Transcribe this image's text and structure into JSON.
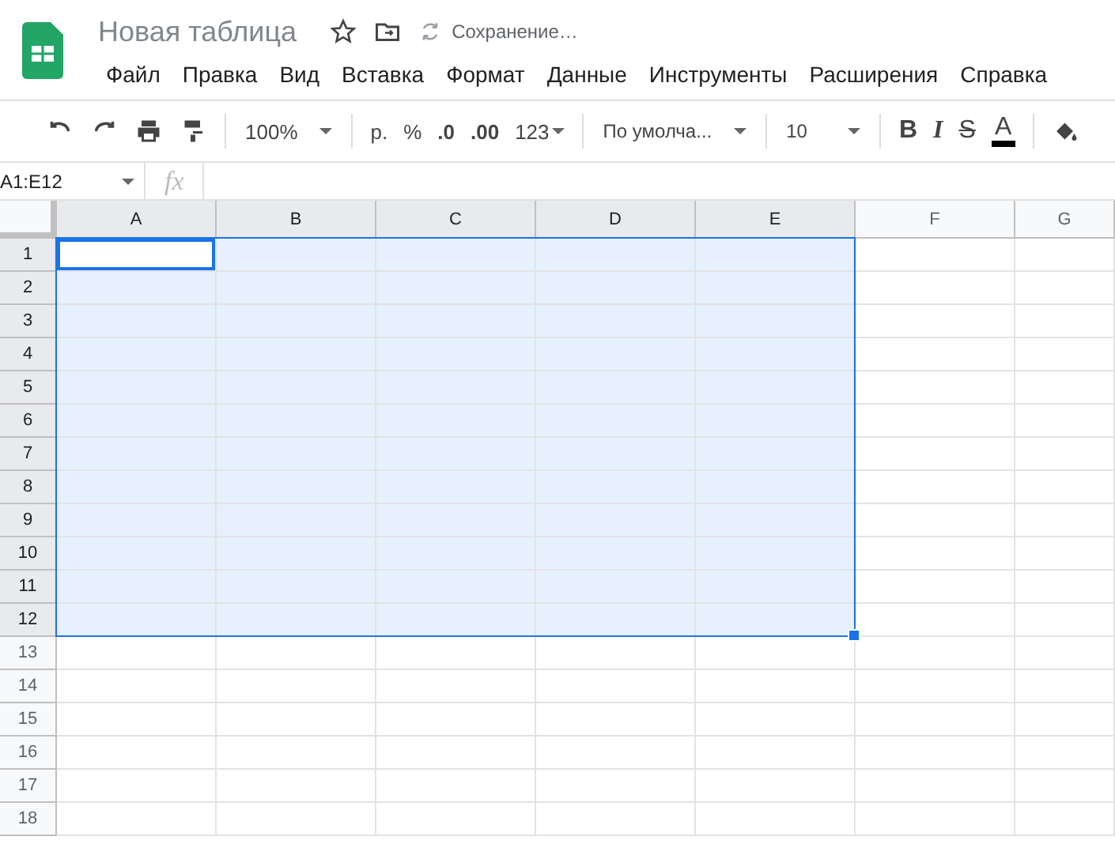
{
  "document": {
    "title": "Новая таблица",
    "save_status": "Сохранение…"
  },
  "menu": [
    "Файл",
    "Правка",
    "Вид",
    "Вставка",
    "Формат",
    "Данные",
    "Инструменты",
    "Расширения",
    "Справка"
  ],
  "toolbar": {
    "zoom": "100%",
    "currency": "р.",
    "percent": "%",
    "decrease_decimals": ".0",
    "increase_decimals": ".00",
    "number_format": "123",
    "font": "По умолча...",
    "font_size": "10",
    "bold": "B",
    "italic": "I",
    "strikethrough": "S",
    "text_color": "A"
  },
  "formula_bar": {
    "name_box": "A1:E12",
    "function_label": "fx"
  },
  "columns": [
    {
      "label": "A",
      "selected": true,
      "active": true
    },
    {
      "label": "B",
      "selected": true,
      "active": false
    },
    {
      "label": "C",
      "selected": true,
      "active": false
    },
    {
      "label": "D",
      "selected": true,
      "active": false
    },
    {
      "label": "E",
      "selected": true,
      "active": false
    },
    {
      "label": "F",
      "selected": false,
      "active": false
    },
    {
      "label": "G",
      "selected": false,
      "active": false
    }
  ],
  "rows": [
    {
      "label": "1",
      "selected": true,
      "active": true
    },
    {
      "label": "2",
      "selected": true,
      "active": false
    },
    {
      "label": "3",
      "selected": true,
      "active": false
    },
    {
      "label": "4",
      "selected": true,
      "active": false
    },
    {
      "label": "5",
      "selected": true,
      "active": false
    },
    {
      "label": "6",
      "selected": true,
      "active": false
    },
    {
      "label": "7",
      "selected": true,
      "active": false
    },
    {
      "label": "8",
      "selected": true,
      "active": false
    },
    {
      "label": "9",
      "selected": true,
      "active": false
    },
    {
      "label": "10",
      "selected": true,
      "active": false
    },
    {
      "label": "11",
      "selected": true,
      "active": false
    },
    {
      "label": "12",
      "selected": true,
      "active": false
    },
    {
      "label": "13",
      "selected": false,
      "active": false
    },
    {
      "label": "14",
      "selected": false,
      "active": false
    },
    {
      "label": "15",
      "selected": false,
      "active": false
    },
    {
      "label": "16",
      "selected": false,
      "active": false
    },
    {
      "label": "17",
      "selected": false,
      "active": false
    },
    {
      "label": "18",
      "selected": false,
      "active": false
    }
  ]
}
